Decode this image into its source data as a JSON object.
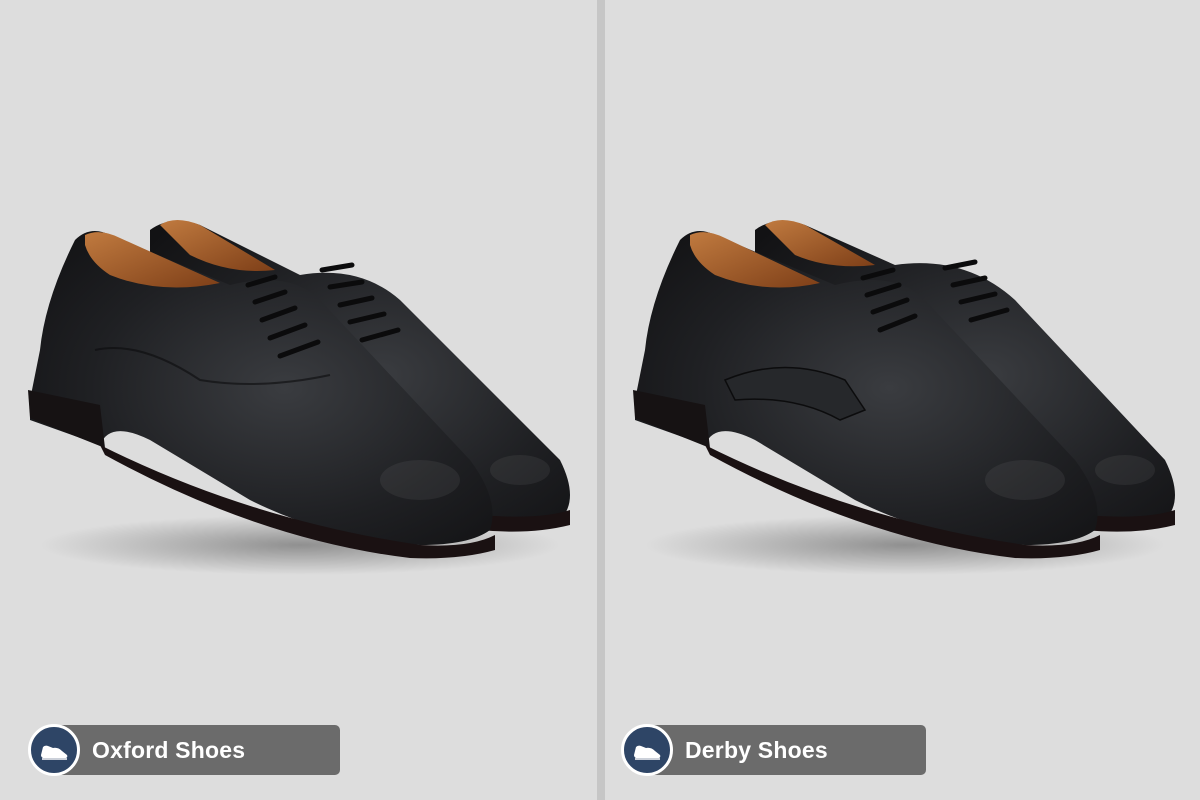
{
  "panels": [
    {
      "label": "Oxford Shoes",
      "icon": "shoe-icon"
    },
    {
      "label": "Derby Shoes",
      "icon": "shoe-icon"
    }
  ],
  "colors": {
    "background": "#dddddd",
    "divider": "#c6c6c6",
    "caption_bar": "#6b6b6b",
    "badge": "#2e4566",
    "shoe_leather": "#1b1c1e",
    "shoe_lining": "#a35a28"
  }
}
